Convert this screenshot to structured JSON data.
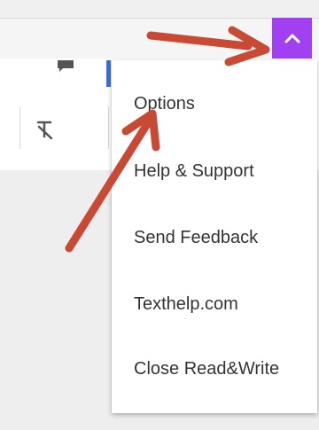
{
  "menu": {
    "items": [
      {
        "label": "Options"
      },
      {
        "label": "Help & Support"
      },
      {
        "label": "Send Feedback"
      },
      {
        "label": "Texthelp.com"
      },
      {
        "label": "Close Read&Write"
      }
    ]
  },
  "colors": {
    "toggle_bg": "#a040f0",
    "arrow": "#c84a34",
    "accent_blue": "#3b6fd8"
  },
  "icons": {
    "toggle": "chevron-up-icon",
    "clear_format": "clear-formatting-icon",
    "comment": "comment-icon"
  }
}
